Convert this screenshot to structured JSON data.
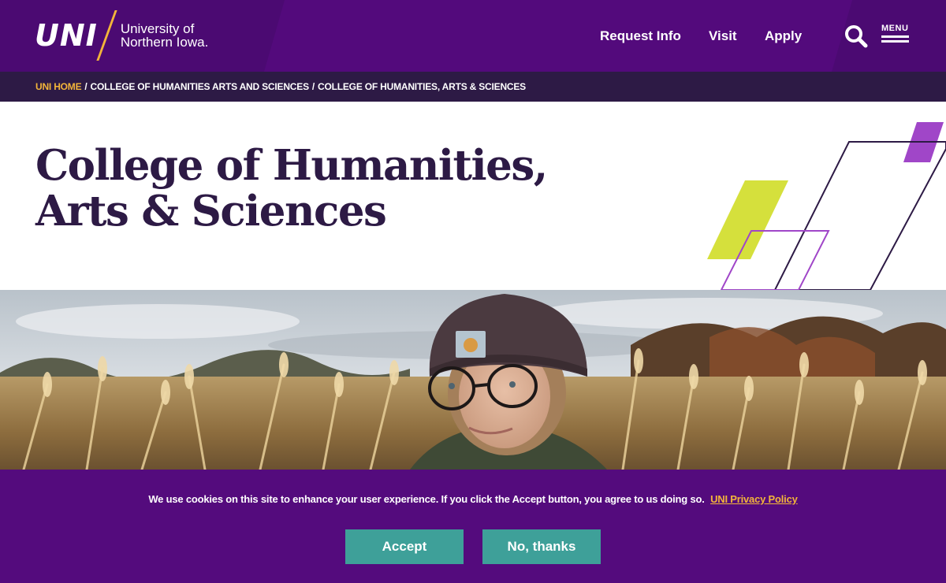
{
  "header": {
    "logo_mark": "UNI",
    "logo_line1": "University of",
    "logo_line2": "Northern Iowa.",
    "nav": {
      "request_info": "Request Info",
      "visit": "Visit",
      "apply": "Apply"
    },
    "search_icon": "search-icon",
    "menu_label": "MENU",
    "menu_icon": "hamburger-icon"
  },
  "breadcrumb": {
    "items": [
      "UNI HOME",
      "COLLEGE OF HUMANITIES ARTS AND SCIENCES",
      "COLLEGE OF HUMANITIES, ARTS & SCIENCES"
    ],
    "separator": "/"
  },
  "page": {
    "title_line1": "College of Humanities,",
    "title_line2": "Arts & Sciences"
  },
  "cookie_banner": {
    "message": "We use cookies on this site to enhance your user experience. If you click the Accept button, you agree to us doing so.",
    "policy_link": "UNI Privacy Policy",
    "accept_label": "Accept",
    "decline_label": "No, thanks"
  },
  "colors": {
    "brand_purple": "#4b0a72",
    "dark_purple": "#2d1a45",
    "gold": "#f3b53a",
    "lime": "#d5e03c",
    "violet_accent": "#a046c8",
    "button_teal": "#3ea099"
  }
}
